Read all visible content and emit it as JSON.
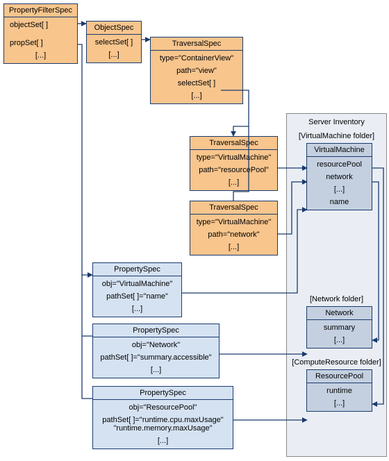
{
  "propertyFilterSpec": {
    "title": "PropertyFilterSpec",
    "rows": [
      "objectSet[ ]",
      "propSet[ ]",
      "[...]"
    ]
  },
  "objectSpec": {
    "title": "ObjectSpec",
    "rows": [
      "selectSet[ ]",
      "[...]"
    ]
  },
  "traversalSpec1": {
    "title": "TraversalSpec",
    "rows": [
      "type=\"ContainerView\"",
      "path=\"view\"",
      "selectSet[ ]",
      "[...]"
    ]
  },
  "traversalSpec2": {
    "title": "TraversalSpec",
    "rows": [
      "type=\"VirtualMachine\"",
      "path=\"resourcePool\"",
      "[...]"
    ]
  },
  "traversalSpec3": {
    "title": "TraversalSpec",
    "rows": [
      "type=\"VirtualMachine\"",
      "path=\"network\"",
      "[...]"
    ]
  },
  "propertySpec1": {
    "title": "PropertySpec",
    "rows": [
      "obj=\"VirtualMachine\"",
      "pathSet[ ]=\"name\"",
      "[...]"
    ]
  },
  "propertySpec2": {
    "title": "PropertySpec",
    "rows": [
      "obj=\"Network\"",
      "pathSet[ ]=\"summary.accessible\"",
      "[...]"
    ]
  },
  "propertySpec3": {
    "title": "PropertySpec",
    "rows": [
      "obj=\"ResourcePool\"",
      "pathSet[ ]=\"runtime.cpu.maxUsage\"\n\"runtime.memory.maxUsage\"",
      "[...]"
    ]
  },
  "serverInventory": {
    "title": "Server Inventory",
    "vmFolder": "[VirtualMachine folder]",
    "vm": {
      "title": "VirtualMachine",
      "rows": [
        "resourcePool",
        "network",
        "[...]",
        "name"
      ]
    },
    "netFolder": "[Network folder]",
    "network": {
      "title": "Network",
      "rows": [
        "summary",
        "[...]"
      ]
    },
    "crFolder": "[ComputeResource folder]",
    "rp": {
      "title": "ResourcePool",
      "rows": [
        "runtime",
        "[...]"
      ]
    }
  }
}
